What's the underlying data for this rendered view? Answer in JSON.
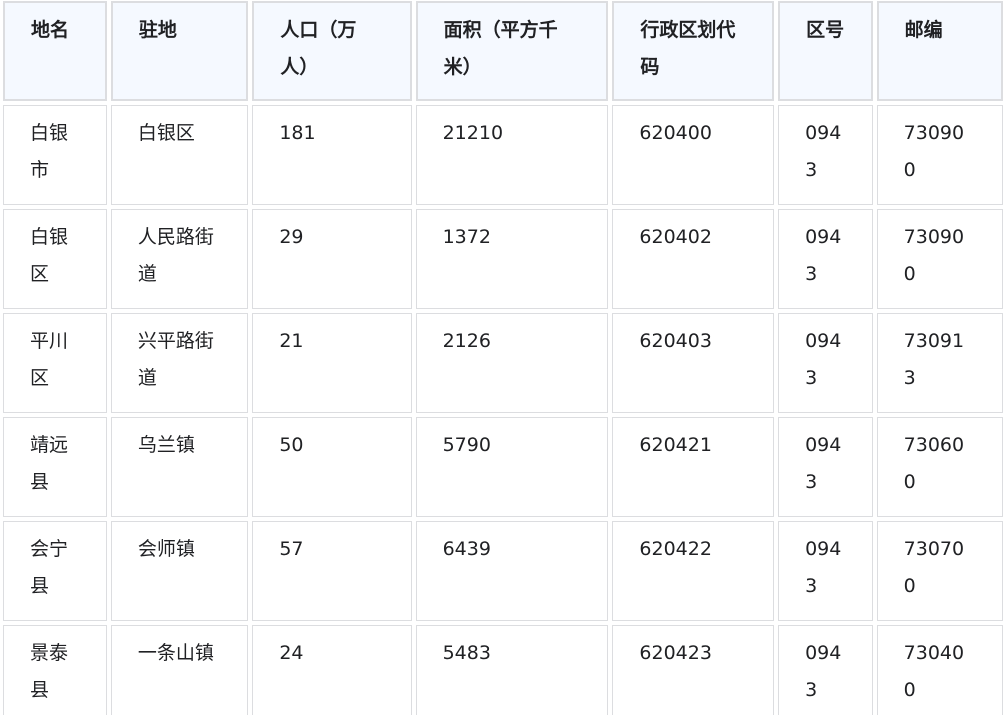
{
  "table": {
    "headers": [
      "地名",
      "驻地",
      "人口（万人）",
      "面积（平方千米）",
      "行政区划代码",
      "区号",
      "邮编"
    ],
    "rows": [
      [
        "白银市",
        "白银区",
        "181",
        "21210",
        "620400",
        "0943",
        "730900"
      ],
      [
        "白银区",
        "人民路街道",
        "29",
        "1372",
        "620402",
        "0943",
        "730900"
      ],
      [
        "平川区",
        "兴平路街道",
        "21",
        "2126",
        "620403",
        "0943",
        "730913"
      ],
      [
        "靖远县",
        "乌兰镇",
        "50",
        "5790",
        "620421",
        "0943",
        "730600"
      ],
      [
        "会宁县",
        "会师镇",
        "57",
        "6439",
        "620422",
        "0943",
        "730700"
      ],
      [
        "景泰县",
        "一条山镇",
        "24",
        "5483",
        "620423",
        "0943",
        "730400"
      ]
    ]
  }
}
